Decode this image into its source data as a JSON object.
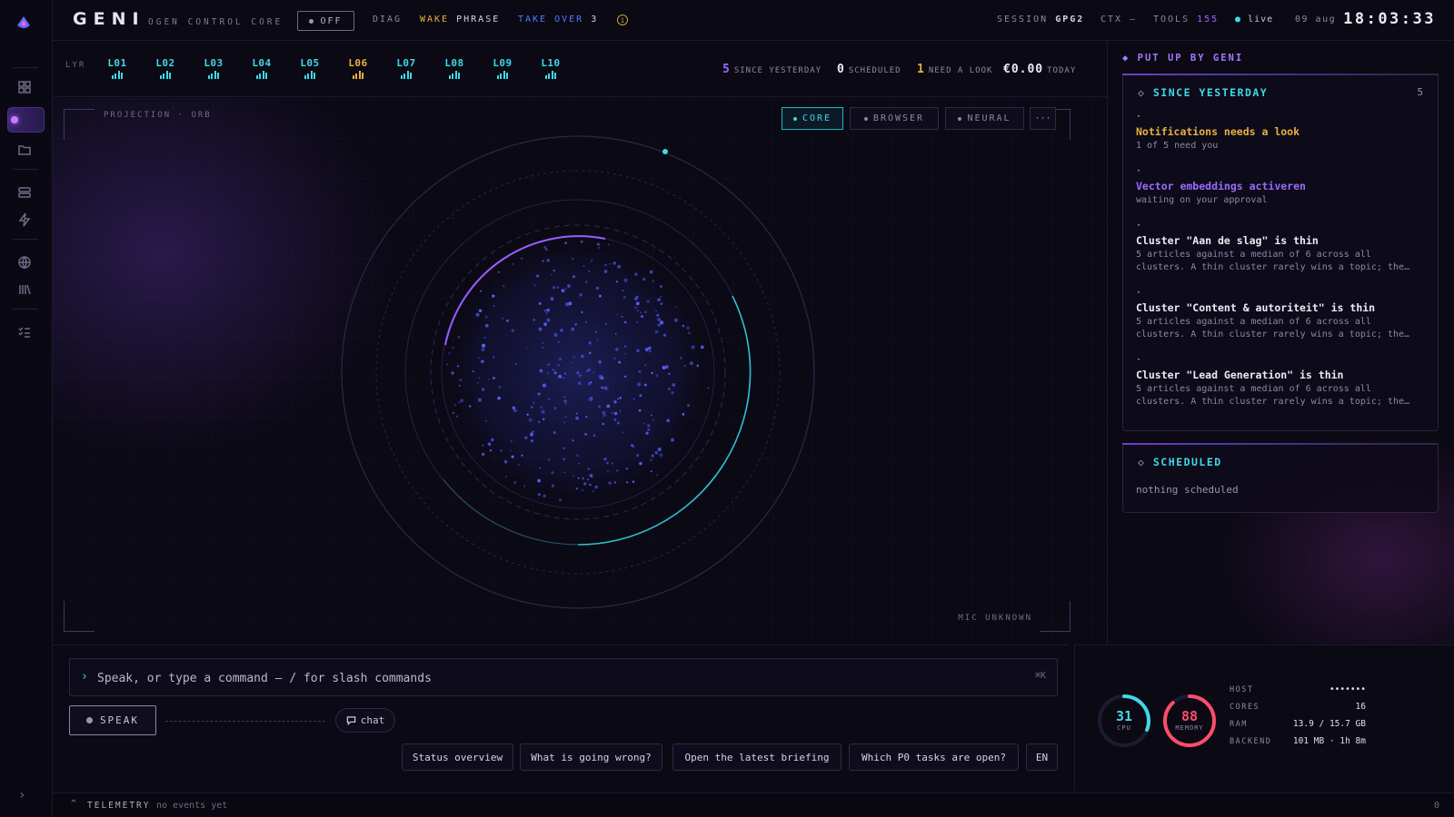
{
  "app": {
    "title": "GENI",
    "subtitle": "OGEN CONTROL CORE",
    "off_label": "OFF",
    "diag_label": "DIAG",
    "wake_label": "WAKE",
    "phrase_label": "PHRASE",
    "takeover_label": "TAKE OVER",
    "takeover_count": "3",
    "session_label": "SESSION",
    "session_value": "GPG2",
    "ctx_label": "CTX",
    "ctx_value": "—",
    "tools_label": "TOOLS",
    "tools_value": "155",
    "live_label": "live",
    "date": "09 aug",
    "clock": "18:03:33"
  },
  "layers": {
    "label": "LYR",
    "items": [
      {
        "name": "L01",
        "color": "#3fd9e8"
      },
      {
        "name": "L02",
        "color": "#3fd9e8"
      },
      {
        "name": "L03",
        "color": "#3fd9e8"
      },
      {
        "name": "L04",
        "color": "#3fd9e8"
      },
      {
        "name": "L05",
        "color": "#3fd9e8"
      },
      {
        "name": "L06",
        "color": "#e8b13f"
      },
      {
        "name": "L07",
        "color": "#3fd9e8"
      },
      {
        "name": "L08",
        "color": "#3fd9e8"
      },
      {
        "name": "L09",
        "color": "#3fd9e8"
      },
      {
        "name": "L10",
        "color": "#3fd9e8"
      }
    ]
  },
  "stats": {
    "since_yesterday_value": "5",
    "since_yesterday_label": "SINCE YESTERDAY",
    "scheduled_value": "0",
    "scheduled_label": "SCHEDULED",
    "need_look_value": "1",
    "need_look_label": "NEED A LOOK",
    "today_value": "€0.00",
    "today_label": "TODAY"
  },
  "stage": {
    "projection_label": "PROJECTION · ORB",
    "mic_label": "MIC UNKNOWN",
    "modes": [
      "CORE",
      "BROWSER",
      "NEURAL"
    ],
    "more_label": "···"
  },
  "panel": {
    "header": "PUT UP BY GENI",
    "since": {
      "title": "SINCE YESTERDAY",
      "count": "5",
      "items": [
        {
          "bullet": "·",
          "title": "Notifications needs a look",
          "desc": "1 of 5 need you",
          "color": "#e8b13f"
        },
        {
          "bullet": "·",
          "title": "Vector embeddings activeren",
          "desc": "waiting on your approval",
          "color": "#9a6bff"
        },
        {
          "bullet": "·",
          "title": "Cluster \"Aan de slag\" is thin",
          "desc": "5 articles against a median of 6 across all clusters. A thin cluster rarely wins a topic; the…",
          "color": "#ecebf3"
        },
        {
          "bullet": "·",
          "title": "Cluster \"Content & autoriteit\" is thin",
          "desc": "5 articles against a median of 6 across all clusters. A thin cluster rarely wins a topic; the…",
          "color": "#ecebf3"
        },
        {
          "bullet": "·",
          "title": "Cluster \"Lead Generation\" is thin",
          "desc": "5 articles against a median of 6 across all clusters. A thin cluster rarely wins a topic; the…",
          "color": "#ecebf3"
        }
      ]
    },
    "scheduled": {
      "title": "SCHEDULED",
      "empty": "nothing scheduled"
    }
  },
  "command": {
    "placeholder": "Speak, or type a command — / for slash commands",
    "shortcut": "⌘K",
    "speak_label": "SPEAK",
    "chat_label": "chat",
    "quick_actions": [
      "Status overview",
      "What is going wrong?",
      "Open the latest briefing",
      "Which P0 tasks are open?",
      "EN"
    ]
  },
  "system": {
    "cpu_value": "31",
    "cpu_label": "CPU",
    "cpu_fraction": 0.31,
    "memory_value": "88",
    "memory_label": "MEMORY",
    "memory_fraction": 0.88,
    "host_label": "HOST",
    "host_value": "•••••••",
    "cores_label": "CORES",
    "cores_value": "16",
    "ram_label": "RAM",
    "ram_value": "13.9 / 15.7 GB",
    "backend_label": "BACKEND",
    "backend_value": "101 MB · 1h 8m"
  },
  "telemetry": {
    "label": "TELEMETRY",
    "events": "no events yet",
    "count": "0"
  },
  "colors": {
    "accent_cyan": "#3fd9e8",
    "accent_purple": "#9a6bff",
    "warning": "#e8b13f",
    "danger": "#ff4d6a"
  }
}
